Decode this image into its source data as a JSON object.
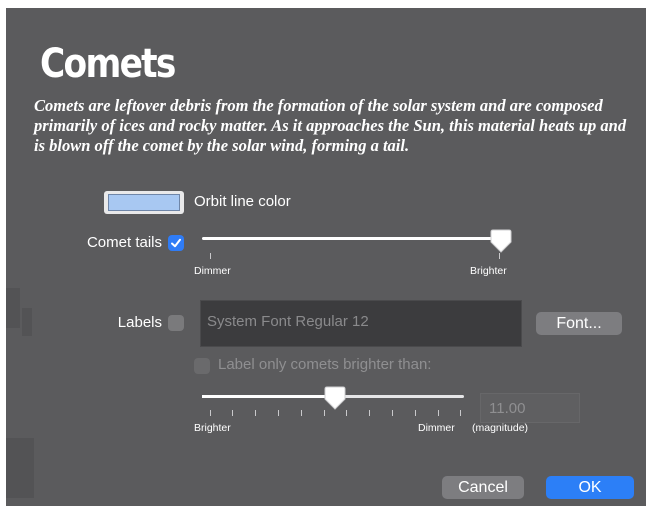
{
  "header": {
    "title": "Comets",
    "description": "Comets are leftover debris from the formation of the solar system and are composed primarily of ices and rocky matter. As it approaches the Sun, this material heats up and is blown off the comet by the solar wind, forming a tail."
  },
  "orbit": {
    "label": "Orbit line color",
    "color": "#a8c8f2"
  },
  "tails": {
    "label": "Comet tails",
    "checked": true,
    "slider_level": 1.0,
    "min_label": "Dimmer",
    "max_label": "Brighter"
  },
  "labels": {
    "label": "Labels",
    "checked": false,
    "font_value": "System Font Regular 12",
    "font_button": "Font..."
  },
  "magnitude": {
    "checkbox_label": "Label only comets brighter than:",
    "checked": false,
    "slider_level": 0.5,
    "min_label": "Brighter",
    "max_label": "Dimmer",
    "value": "11.00",
    "unit_label": "(magnitude)"
  },
  "footer": {
    "cancel_label": "Cancel",
    "ok_label": "OK"
  },
  "colors": {
    "panel": "#5b5b5d",
    "accent": "#2c7ff7"
  }
}
